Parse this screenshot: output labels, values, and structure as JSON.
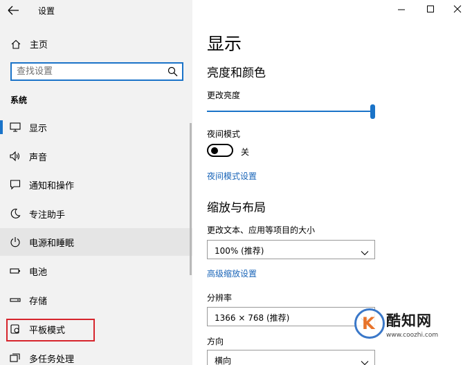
{
  "titlebar": {
    "title": "设置"
  },
  "sidebar": {
    "home_label": "主页",
    "search_placeholder": "查找设置",
    "section": "系统",
    "items": [
      {
        "label": "显示",
        "icon": "monitor-icon"
      },
      {
        "label": "声音",
        "icon": "speaker-icon"
      },
      {
        "label": "通知和操作",
        "icon": "notification-icon"
      },
      {
        "label": "专注助手",
        "icon": "moon-icon"
      },
      {
        "label": "电源和睡眠",
        "icon": "power-icon"
      },
      {
        "label": "电池",
        "icon": "battery-icon"
      },
      {
        "label": "存储",
        "icon": "storage-icon"
      },
      {
        "label": "平板模式",
        "icon": "tablet-mode-icon"
      },
      {
        "label": "多任务处理",
        "icon": "multitasking-icon"
      }
    ],
    "active_index": 0,
    "hover_index": 4,
    "highlight_color": "#d6242c"
  },
  "main": {
    "title": "显示",
    "brightness_section": "亮度和颜色",
    "brightness_label": "更改亮度",
    "brightness_value": 1.0,
    "night_mode_label": "夜间模式",
    "night_mode_state": "关",
    "night_mode_settings_link": "夜间模式设置",
    "scale_section": "缩放与布局",
    "scale_label": "更改文本、应用等项目的大小",
    "scale_value": "100% (推荐)",
    "advanced_scale_link": "高级缩放设置",
    "resolution_label": "分辨率",
    "resolution_value": "1366 × 768 (推荐)",
    "orientation_label": "方向",
    "orientation_value": "横向"
  },
  "watermark": {
    "brand": "酷知网",
    "url": "www.coozhi.com",
    "k": "K"
  },
  "colors": {
    "accent": "#1a73c8",
    "link": "#1a65b8",
    "sidebar_bg": "#f2f2f2"
  }
}
